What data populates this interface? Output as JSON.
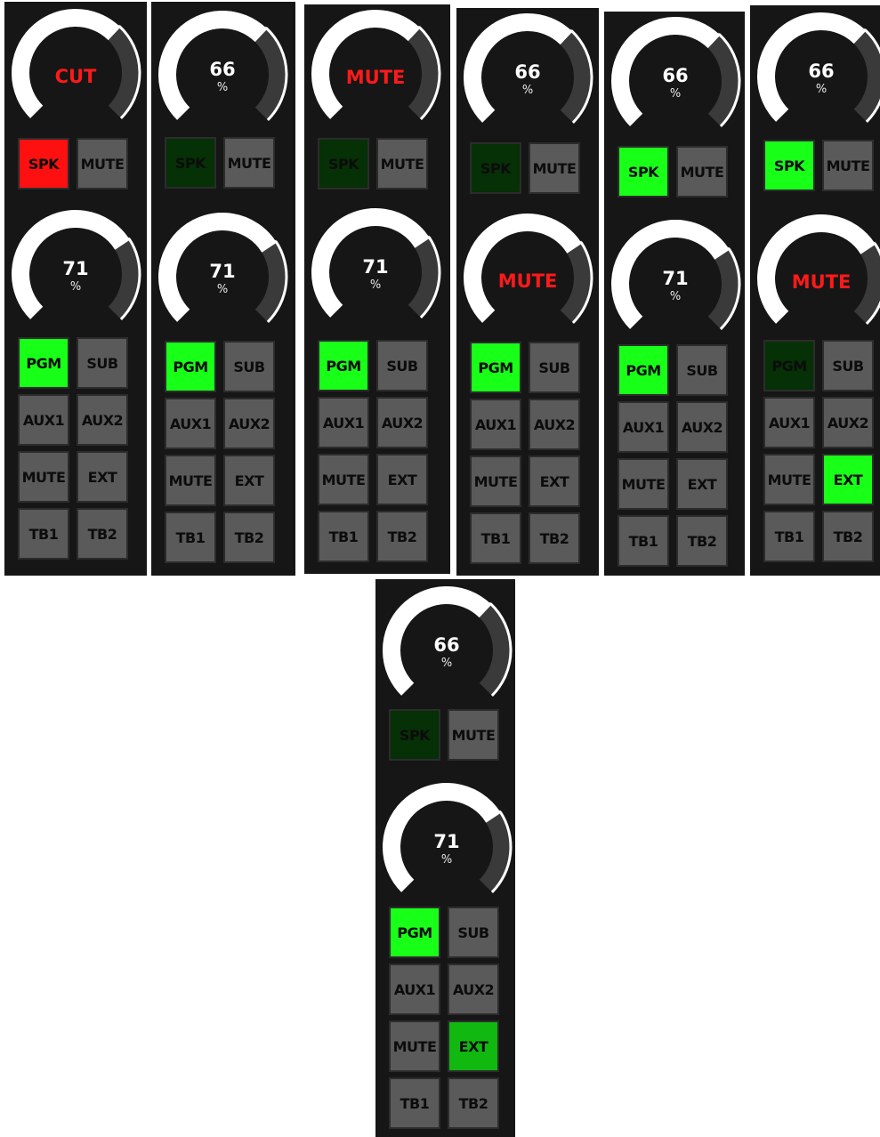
{
  "colors": {
    "panel": "#161616",
    "button_off": "#5a5a5a",
    "button_on": "#18ff18",
    "button_dim": "#063006",
    "button_alert": "#ff1010",
    "button_mid": "#10b810",
    "knob_arc": "#ffffff",
    "knob_track": "#3a3a3a",
    "mute_text": "#ff1a1a"
  },
  "panels": [
    {
      "name": "strip-1",
      "top_knob": {
        "text": "CUT",
        "unit": "",
        "muted": true,
        "level": 0.66
      },
      "top_buttons": [
        {
          "label": "SPK",
          "state": "alert"
        },
        {
          "label": "MUTE",
          "state": "off"
        }
      ],
      "bottom_knob": {
        "text": "71",
        "unit": "%",
        "muted": false,
        "level": 0.71
      },
      "buttons": [
        {
          "label": "PGM",
          "state": "on"
        },
        {
          "label": "SUB",
          "state": "off"
        },
        {
          "label": "AUX1",
          "state": "off"
        },
        {
          "label": "AUX2",
          "state": "off"
        },
        {
          "label": "MUTE",
          "state": "off"
        },
        {
          "label": "EXT",
          "state": "off"
        },
        {
          "label": "TB1",
          "state": "off"
        },
        {
          "label": "TB2",
          "state": "off"
        }
      ]
    },
    {
      "name": "strip-2",
      "top_knob": {
        "text": "66",
        "unit": "%",
        "muted": false,
        "level": 0.66
      },
      "top_buttons": [
        {
          "label": "SPK",
          "state": "dim"
        },
        {
          "label": "MUTE",
          "state": "off"
        }
      ],
      "bottom_knob": {
        "text": "71",
        "unit": "%",
        "muted": false,
        "level": 0.71
      },
      "buttons": [
        {
          "label": "PGM",
          "state": "on"
        },
        {
          "label": "SUB",
          "state": "off"
        },
        {
          "label": "AUX1",
          "state": "off"
        },
        {
          "label": "AUX2",
          "state": "off"
        },
        {
          "label": "MUTE",
          "state": "off"
        },
        {
          "label": "EXT",
          "state": "off"
        },
        {
          "label": "TB1",
          "state": "off"
        },
        {
          "label": "TB2",
          "state": "off"
        }
      ]
    },
    {
      "name": "strip-3",
      "top_knob": {
        "text": "MUTE",
        "unit": "",
        "muted": true,
        "level": 0.66
      },
      "top_buttons": [
        {
          "label": "SPK",
          "state": "dim"
        },
        {
          "label": "MUTE",
          "state": "off"
        }
      ],
      "bottom_knob": {
        "text": "71",
        "unit": "%",
        "muted": false,
        "level": 0.71
      },
      "buttons": [
        {
          "label": "PGM",
          "state": "on"
        },
        {
          "label": "SUB",
          "state": "off"
        },
        {
          "label": "AUX1",
          "state": "off"
        },
        {
          "label": "AUX2",
          "state": "off"
        },
        {
          "label": "MUTE",
          "state": "off"
        },
        {
          "label": "EXT",
          "state": "off"
        },
        {
          "label": "TB1",
          "state": "off"
        },
        {
          "label": "TB2",
          "state": "off"
        }
      ]
    },
    {
      "name": "strip-4",
      "top_knob": {
        "text": "66",
        "unit": "%",
        "muted": false,
        "level": 0.66
      },
      "top_buttons": [
        {
          "label": "SPK",
          "state": "dim"
        },
        {
          "label": "MUTE",
          "state": "off"
        }
      ],
      "bottom_knob": {
        "text": "MUTE",
        "unit": "",
        "muted": true,
        "level": 0.71
      },
      "buttons": [
        {
          "label": "PGM",
          "state": "on"
        },
        {
          "label": "SUB",
          "state": "off"
        },
        {
          "label": "AUX1",
          "state": "off"
        },
        {
          "label": "AUX2",
          "state": "off"
        },
        {
          "label": "MUTE",
          "state": "off"
        },
        {
          "label": "EXT",
          "state": "off"
        },
        {
          "label": "TB1",
          "state": "off"
        },
        {
          "label": "TB2",
          "state": "off"
        }
      ]
    },
    {
      "name": "strip-5",
      "top_knob": {
        "text": "66",
        "unit": "%",
        "muted": false,
        "level": 0.66
      },
      "top_buttons": [
        {
          "label": "SPK",
          "state": "on"
        },
        {
          "label": "MUTE",
          "state": "off"
        }
      ],
      "bottom_knob": {
        "text": "71",
        "unit": "%",
        "muted": false,
        "level": 0.71
      },
      "buttons": [
        {
          "label": "PGM",
          "state": "on"
        },
        {
          "label": "SUB",
          "state": "off"
        },
        {
          "label": "AUX1",
          "state": "off"
        },
        {
          "label": "AUX2",
          "state": "off"
        },
        {
          "label": "MUTE",
          "state": "off"
        },
        {
          "label": "EXT",
          "state": "off"
        },
        {
          "label": "TB1",
          "state": "off"
        },
        {
          "label": "TB2",
          "state": "off"
        }
      ]
    },
    {
      "name": "strip-6",
      "top_knob": {
        "text": "66",
        "unit": "%",
        "muted": false,
        "level": 0.66
      },
      "top_buttons": [
        {
          "label": "SPK",
          "state": "on"
        },
        {
          "label": "MUTE",
          "state": "off"
        }
      ],
      "bottom_knob": {
        "text": "MUTE",
        "unit": "",
        "muted": true,
        "level": 0.71
      },
      "buttons": [
        {
          "label": "PGM",
          "state": "dim"
        },
        {
          "label": "SUB",
          "state": "off"
        },
        {
          "label": "AUX1",
          "state": "off"
        },
        {
          "label": "AUX2",
          "state": "off"
        },
        {
          "label": "MUTE",
          "state": "off"
        },
        {
          "label": "EXT",
          "state": "on"
        },
        {
          "label": "TB1",
          "state": "off"
        },
        {
          "label": "TB2",
          "state": "off"
        }
      ]
    },
    {
      "name": "strip-7",
      "top_knob": {
        "text": "66",
        "unit": "%",
        "muted": false,
        "level": 0.66
      },
      "top_buttons": [
        {
          "label": "SPK",
          "state": "dim"
        },
        {
          "label": "MUTE",
          "state": "off"
        }
      ],
      "bottom_knob": {
        "text": "71",
        "unit": "%",
        "muted": false,
        "level": 0.71
      },
      "buttons": [
        {
          "label": "PGM",
          "state": "on"
        },
        {
          "label": "SUB",
          "state": "off"
        },
        {
          "label": "AUX1",
          "state": "off"
        },
        {
          "label": "AUX2",
          "state": "off"
        },
        {
          "label": "MUTE",
          "state": "off"
        },
        {
          "label": "EXT",
          "state": "mid"
        },
        {
          "label": "TB1",
          "state": "off"
        },
        {
          "label": "TB2",
          "state": "off"
        }
      ]
    }
  ]
}
